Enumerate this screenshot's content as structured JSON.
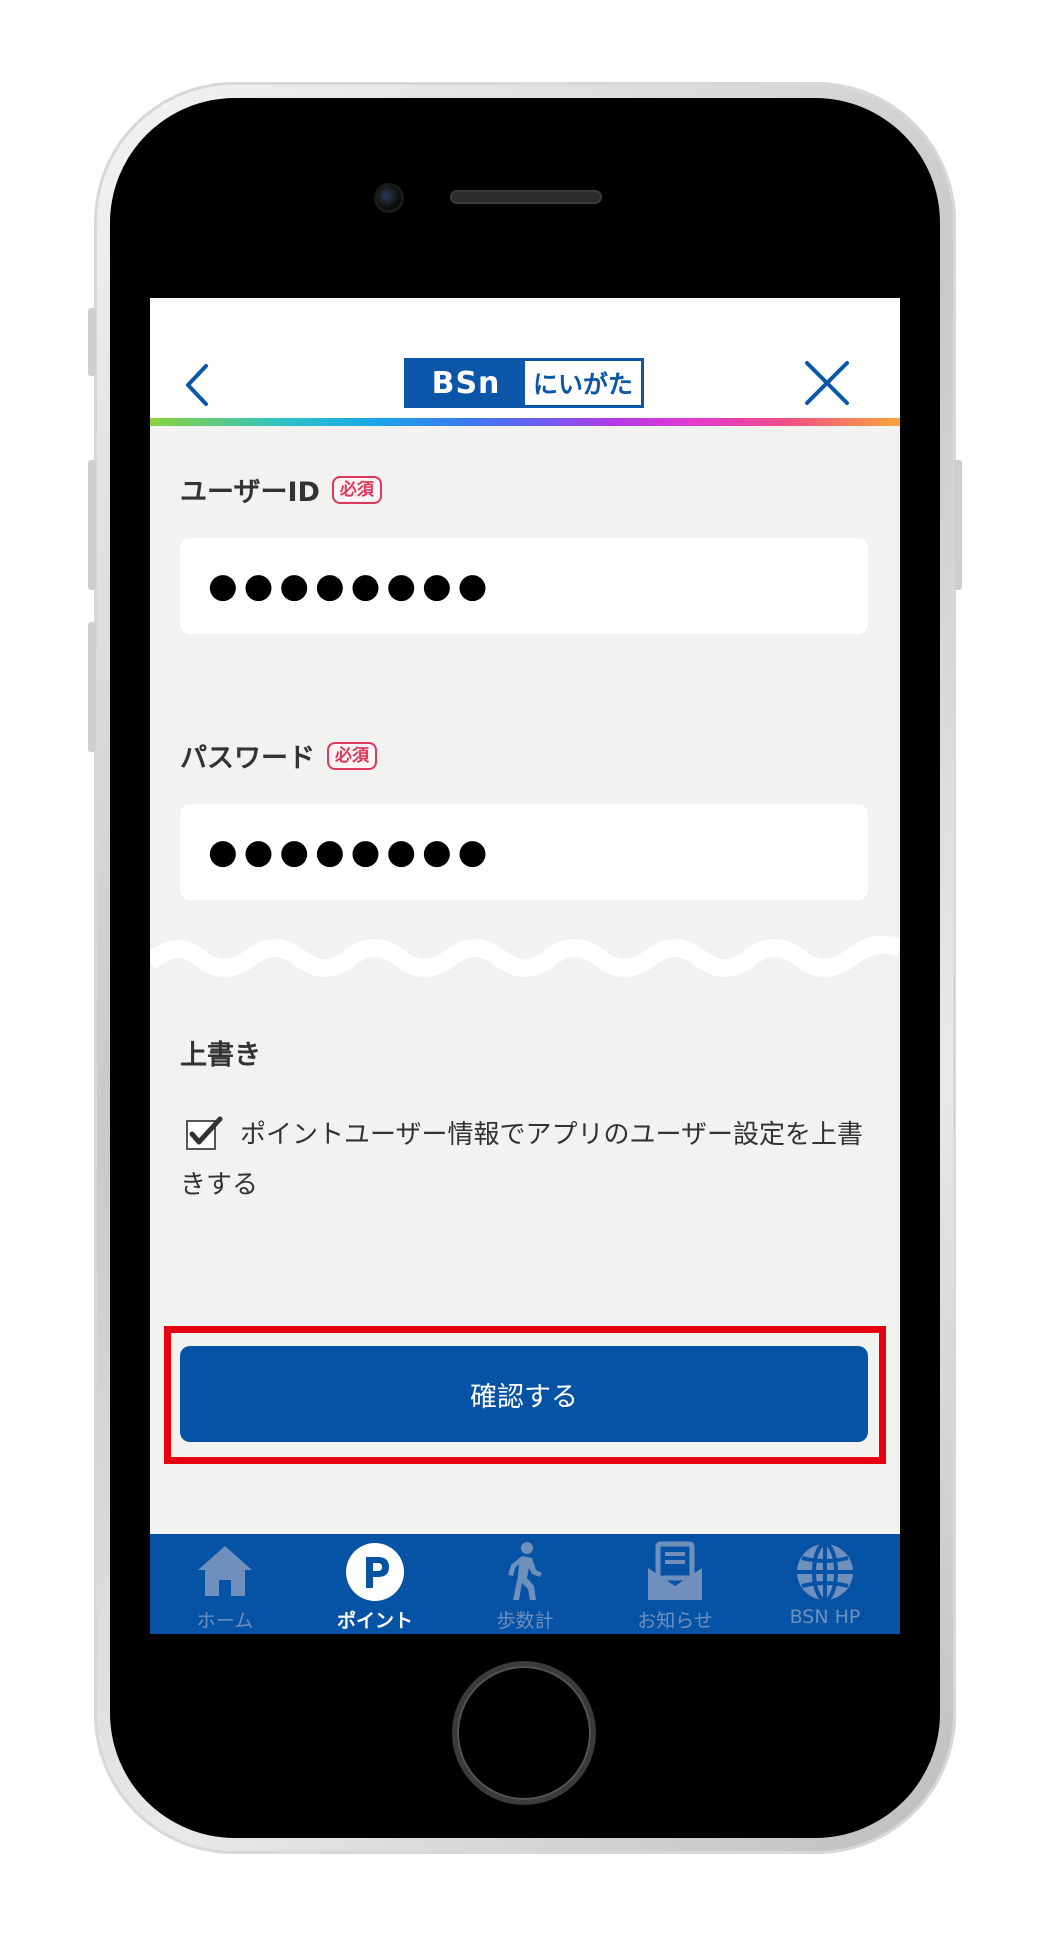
{
  "header": {
    "logo_left": "BSn",
    "logo_right": "にいがた"
  },
  "user_id": {
    "label": "ユーザーID",
    "required_badge": "必須",
    "value": "●●●●●●●●"
  },
  "password": {
    "label": "パスワード",
    "required_badge": "必須",
    "value": "●●●●●●●●"
  },
  "overwrite": {
    "title": "上書き",
    "checkbox_label": "ポイントユーザー情報でアプリのユーザー設定を上書きする",
    "checked": true
  },
  "confirm_button": {
    "label": "確認する"
  },
  "tabs": [
    {
      "label": "ホーム",
      "icon": "home-icon",
      "active": false
    },
    {
      "label": "ポイント",
      "icon": "point-icon",
      "active": true
    },
    {
      "label": "歩数計",
      "icon": "walking-icon",
      "active": false
    },
    {
      "label": "お知らせ",
      "icon": "mail-icon",
      "active": false
    },
    {
      "label": "BSN HP",
      "icon": "globe-icon",
      "active": false
    }
  ],
  "colors": {
    "brand_blue": "#0653a6",
    "required_red": "#e0365a",
    "highlight_red": "#e60012"
  }
}
